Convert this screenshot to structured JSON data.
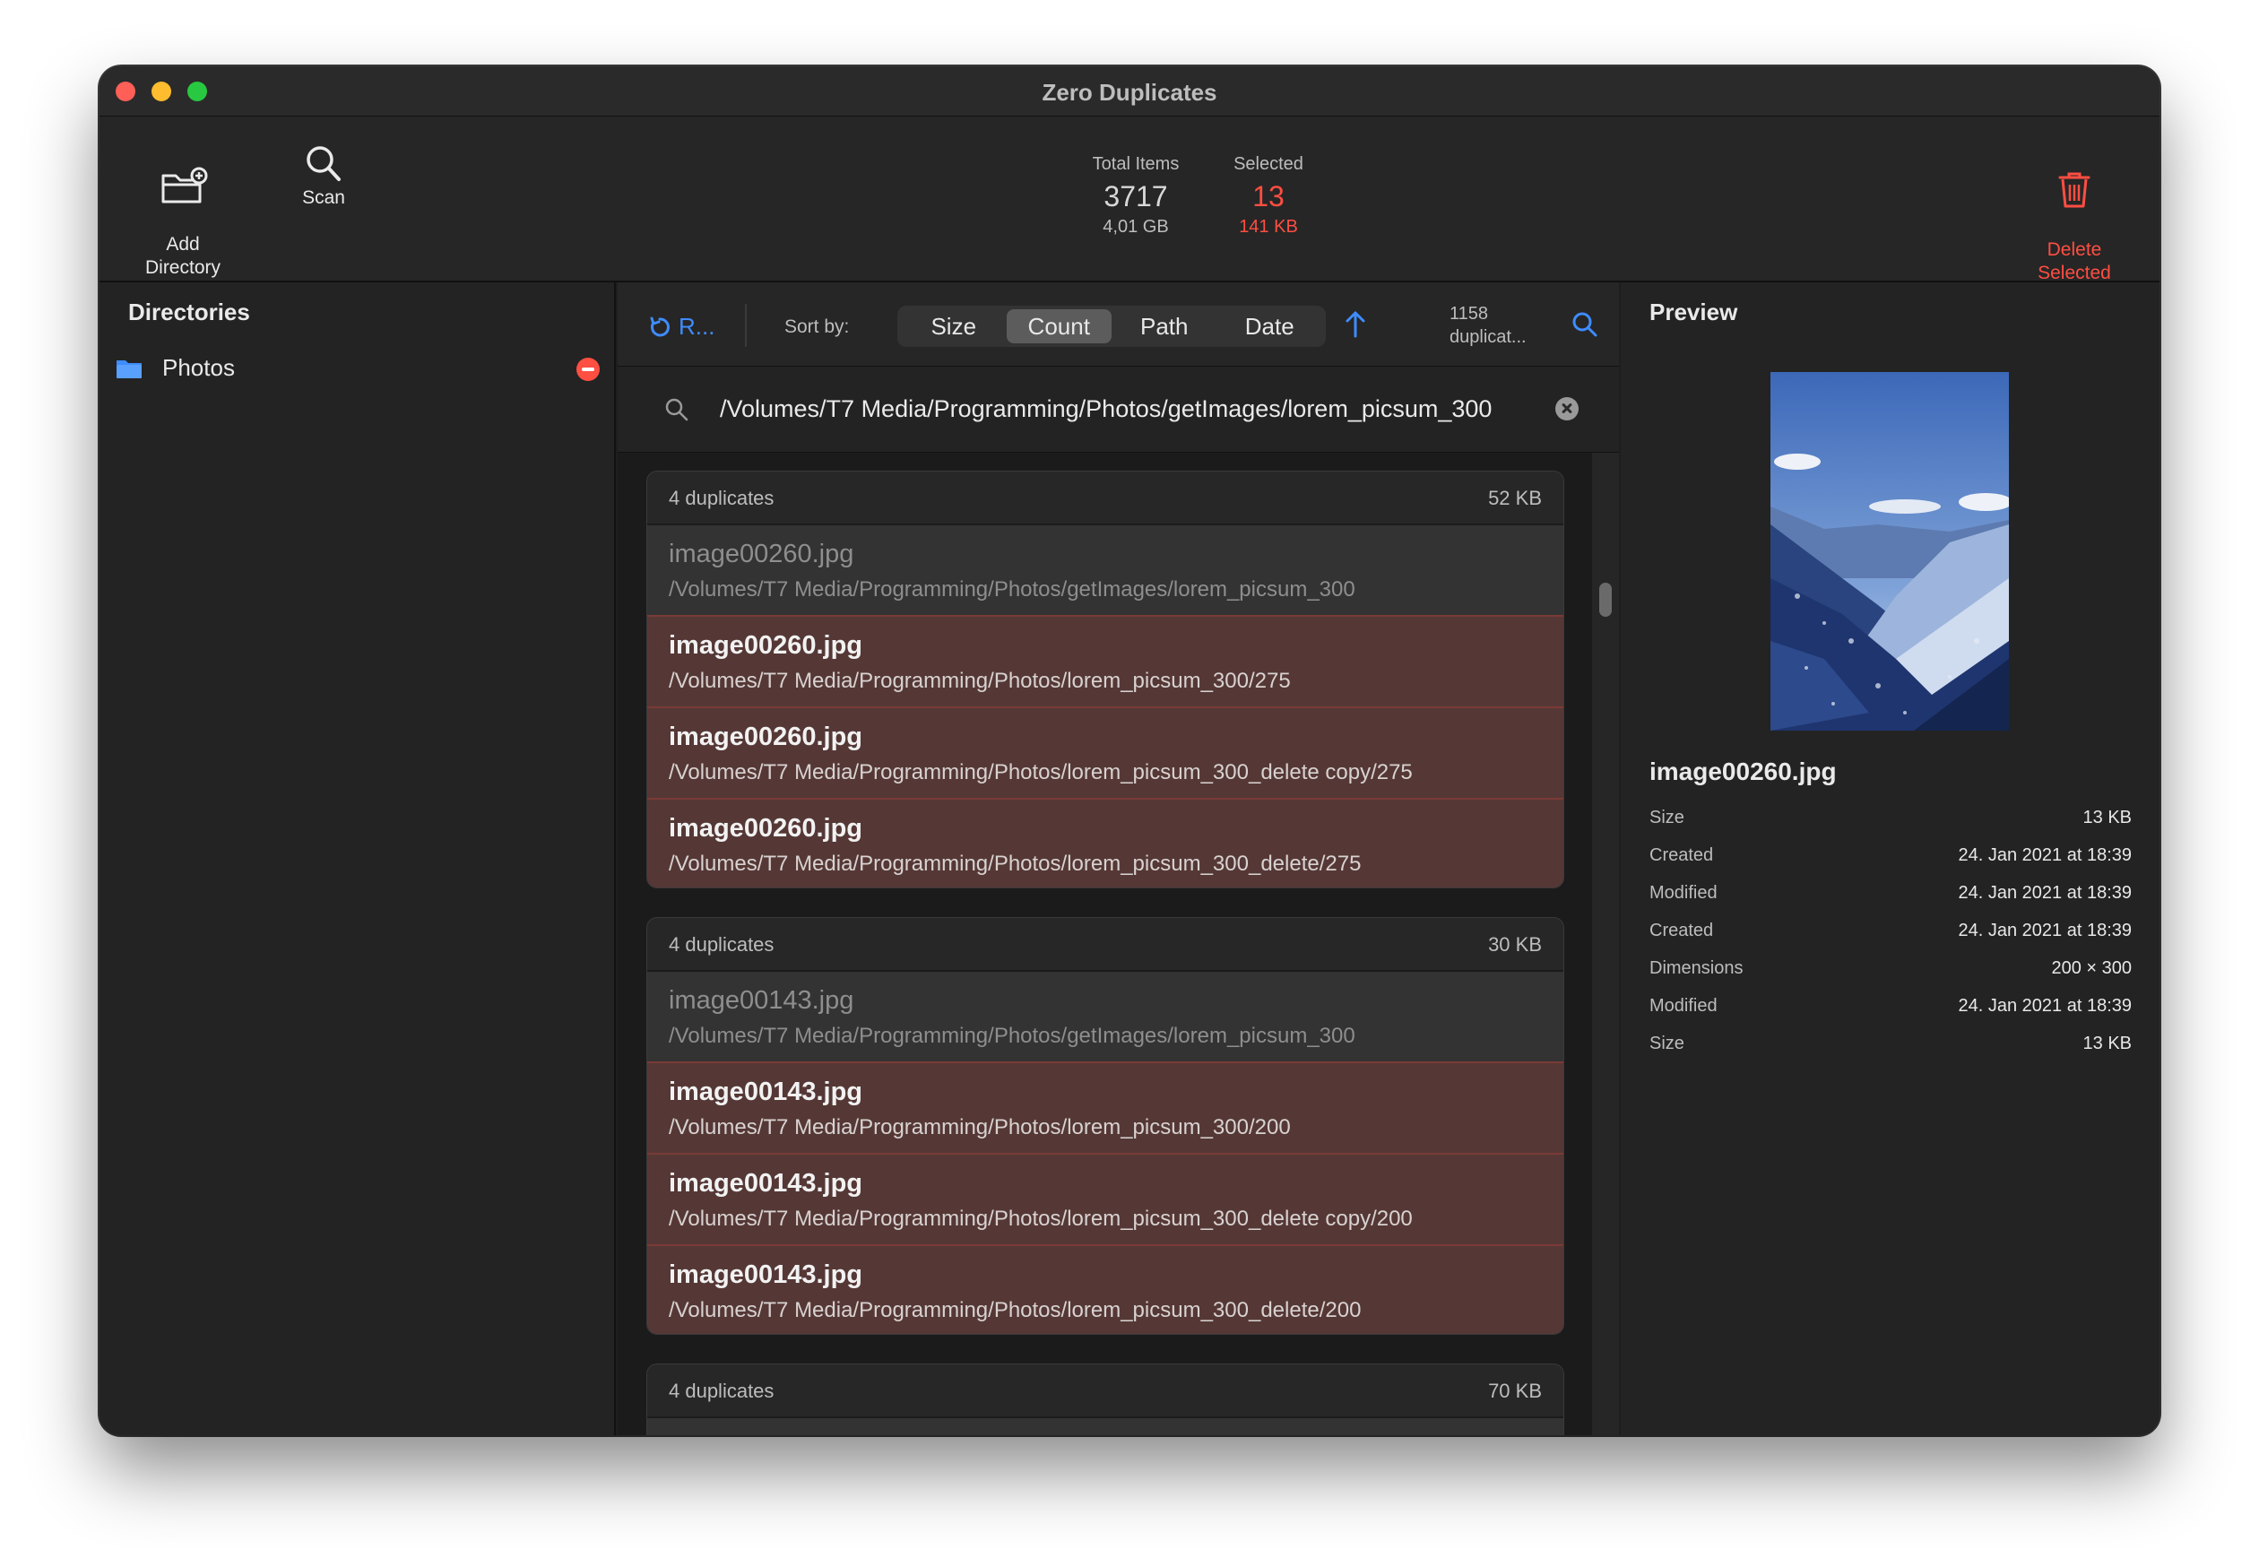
{
  "window": {
    "title": "Zero Duplicates"
  },
  "toolbar": {
    "add_directory_label": "Add\nDirectory",
    "scan_label": "Scan",
    "total_items_label": "Total Items",
    "total_items_count": "3717",
    "total_items_size": "4,01 GB",
    "selected_label": "Selected",
    "selected_count": "13",
    "selected_size": "141 KB",
    "delete_selected_label": "Delete\nSelected",
    "accent_color": "#ff4e42"
  },
  "sidebar": {
    "title": "Directories",
    "directories": [
      {
        "name": "Photos",
        "icon": "folder-icon"
      }
    ]
  },
  "sortbar": {
    "refresh_label": "R...",
    "sort_by_label": "Sort by:",
    "options": [
      "Size",
      "Count",
      "Path",
      "Date"
    ],
    "active_option": "Count",
    "direction": "ascending",
    "duplicates_count": "1158",
    "duplicates_label": "duplicat..."
  },
  "search": {
    "query": "/Volumes/T7 Media/Programming/Photos/getImages/lorem_picsum_300"
  },
  "groups": [
    {
      "count_label": "4 duplicates",
      "size": "52 KB",
      "items": [
        {
          "name": "image00260.jpg",
          "path": "/Volumes/T7 Media/Programming/Photos/getImages/lorem_picsum_300",
          "selected": false
        },
        {
          "name": "image00260.jpg",
          "path": "/Volumes/T7 Media/Programming/Photos/lorem_picsum_300/275",
          "selected": true
        },
        {
          "name": "image00260.jpg",
          "path": "/Volumes/T7 Media/Programming/Photos/lorem_picsum_300_delete copy/275",
          "selected": true
        },
        {
          "name": "image00260.jpg",
          "path": "/Volumes/T7 Media/Programming/Photos/lorem_picsum_300_delete/275",
          "selected": true
        }
      ]
    },
    {
      "count_label": "4 duplicates",
      "size": "30 KB",
      "items": [
        {
          "name": "image00143.jpg",
          "path": "/Volumes/T7 Media/Programming/Photos/getImages/lorem_picsum_300",
          "selected": false
        },
        {
          "name": "image00143.jpg",
          "path": "/Volumes/T7 Media/Programming/Photos/lorem_picsum_300/200",
          "selected": true
        },
        {
          "name": "image00143.jpg",
          "path": "/Volumes/T7 Media/Programming/Photos/lorem_picsum_300_delete copy/200",
          "selected": true
        },
        {
          "name": "image00143.jpg",
          "path": "/Volumes/T7 Media/Programming/Photos/lorem_picsum_300_delete/200",
          "selected": true
        }
      ]
    },
    {
      "count_label": "4 duplicates",
      "size": "70 KB",
      "items": []
    }
  ],
  "preview": {
    "title": "Preview",
    "file_name": "image00260.jpg",
    "metadata": [
      {
        "key": "Size",
        "value": "13 KB"
      },
      {
        "key": "Created",
        "value": "24. Jan 2021 at 18:39"
      },
      {
        "key": "Modified",
        "value": "24. Jan 2021 at 18:39"
      },
      {
        "key": "Created",
        "value": "24. Jan 2021 at 18:39"
      },
      {
        "key": "Dimensions",
        "value": "200 × 300"
      },
      {
        "key": "Modified",
        "value": "24. Jan 2021 at 18:39"
      },
      {
        "key": "Size",
        "value": "13 KB"
      }
    ]
  }
}
